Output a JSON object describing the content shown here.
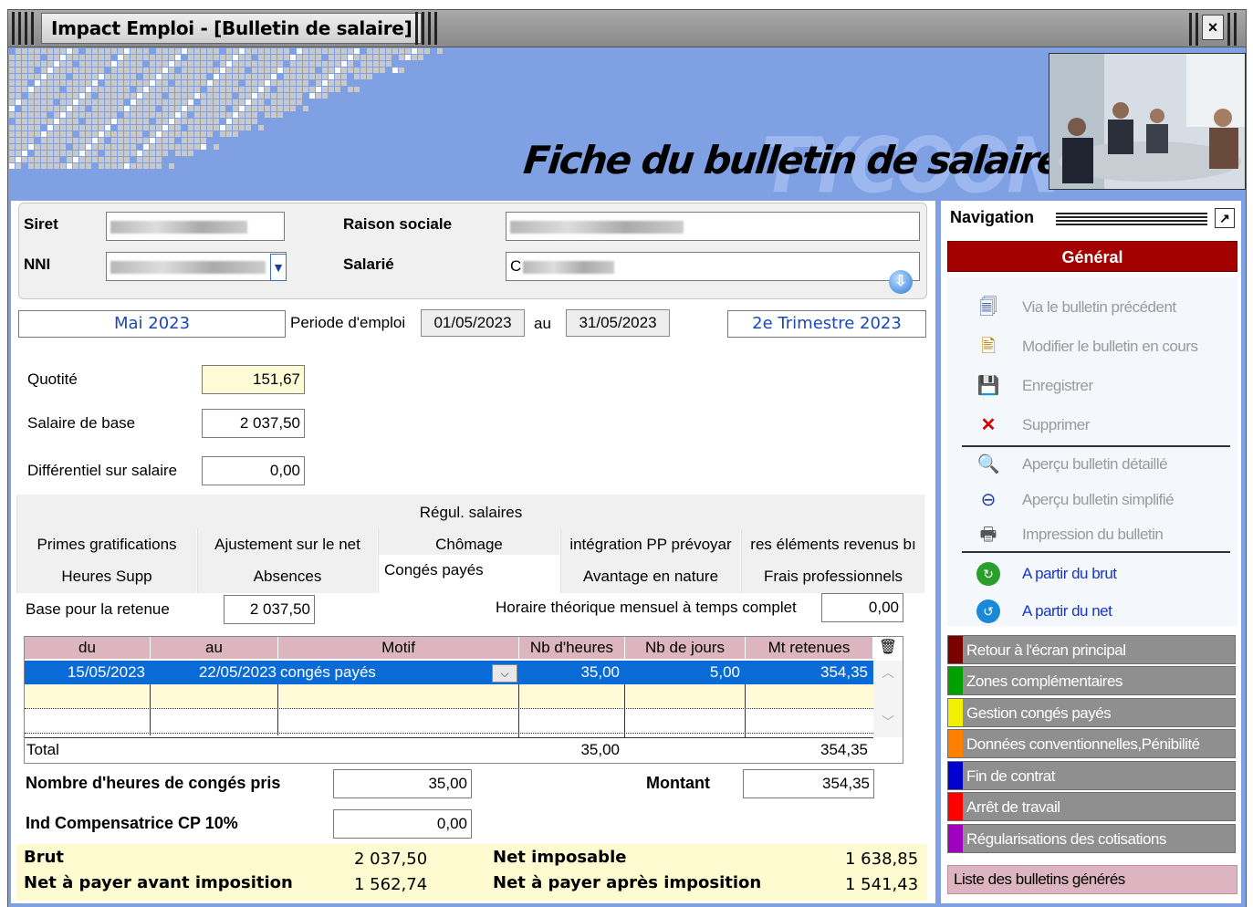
{
  "window": {
    "title": "Impact Emploi - [Bulletin de salaire]",
    "close_glyph": "×"
  },
  "banner": {
    "brand": "TYCOON",
    "title": "Fiche du bulletin de salaire"
  },
  "identity": {
    "siret_label": "Siret",
    "nni_label": "NNI",
    "raison_label": "Raison sociale",
    "salarie_label": "Salarié",
    "salarie_value_initial": "C"
  },
  "period": {
    "month": "Mai 2023",
    "periode_label": "Periode d'emploi",
    "start": "01/05/2023",
    "au_label": "au",
    "end": "31/05/2023",
    "trimestre": "2e Trimestre  2023"
  },
  "salary": {
    "quotite_label": "Quotité",
    "quotite_value": "151,67",
    "base_label": "Salaire de base",
    "base_value": "2 037,50",
    "diff_label": "Différentiel sur salaire",
    "diff_value": "0,00"
  },
  "tabs": {
    "row1": [
      "Régul. salaires"
    ],
    "row2": [
      "Primes gratifications",
      "Ajustement sur le net",
      "Chômage",
      "intégration PP prévoyar",
      "res éléments revenus bı"
    ],
    "row3": [
      "Heures Supp",
      "Absences",
      "Congés payés",
      "Avantage en nature",
      "Frais professionnels"
    ],
    "active": "Congés payés"
  },
  "conges": {
    "base_label": "Base pour la retenue",
    "base_value": "2 037,50",
    "horaire_label": "Horaire théorique mensuel à temps complet",
    "horaire_value": "0,00",
    "columns": [
      "du",
      "au",
      "Motif",
      "Nb d'heures",
      "Nb de jours",
      "Mt retenues"
    ],
    "rows": [
      {
        "du": "15/05/2023",
        "au": "22/05/2023",
        "motif": "congés payés",
        "heures": "35,00",
        "jours": "5,00",
        "montant": "354,35"
      }
    ],
    "total_label": "Total",
    "total_heures": "35,00",
    "total_montant": "354,35",
    "nb_heures_label": "Nombre d'heures de congés pris",
    "nb_heures_value": "35,00",
    "montant_label": "Montant",
    "montant_value": "354,35",
    "ind_label": "Ind Compensatrice CP 10%",
    "ind_value": "0,00"
  },
  "totals": {
    "brut_label": "Brut",
    "brut_value": "2 037,50",
    "net_imposable_label": "Net imposable",
    "net_imposable_value": "1 638,85",
    "net_avant_label": "Net à payer avant imposition",
    "net_avant_value": "1 562,74",
    "net_apres_label": "Net à payer après imposition",
    "net_apres_value": "1 541,43"
  },
  "navigation": {
    "title": "Navigation",
    "general": "Général",
    "items": [
      "Via le bulletin précédent",
      "Modifier le bulletin en cours",
      "Enregistrer",
      "Supprimer",
      "Aperçu bulletin détaillé",
      "Aperçu bulletin simplifié",
      "Impression du bulletin",
      "A partir du brut",
      "A partir du net"
    ],
    "sections": [
      {
        "label": "Retour à l'écran principal",
        "color": "#7a0000"
      },
      {
        "label": "Zones complémentaires",
        "color": "#00a000"
      },
      {
        "label": "Gestion congés payés",
        "color": "#f0f000"
      },
      {
        "label": "Données conventionnelles,Pénibilité",
        "color": "#ff8000"
      },
      {
        "label": "Fin de contrat",
        "color": "#0000d0"
      },
      {
        "label": "Arrêt de travail",
        "color": "#ff0000"
      },
      {
        "label": "Régularisations des cotisations",
        "color": "#a000c0"
      }
    ],
    "liste": "Liste des bulletins générés"
  }
}
